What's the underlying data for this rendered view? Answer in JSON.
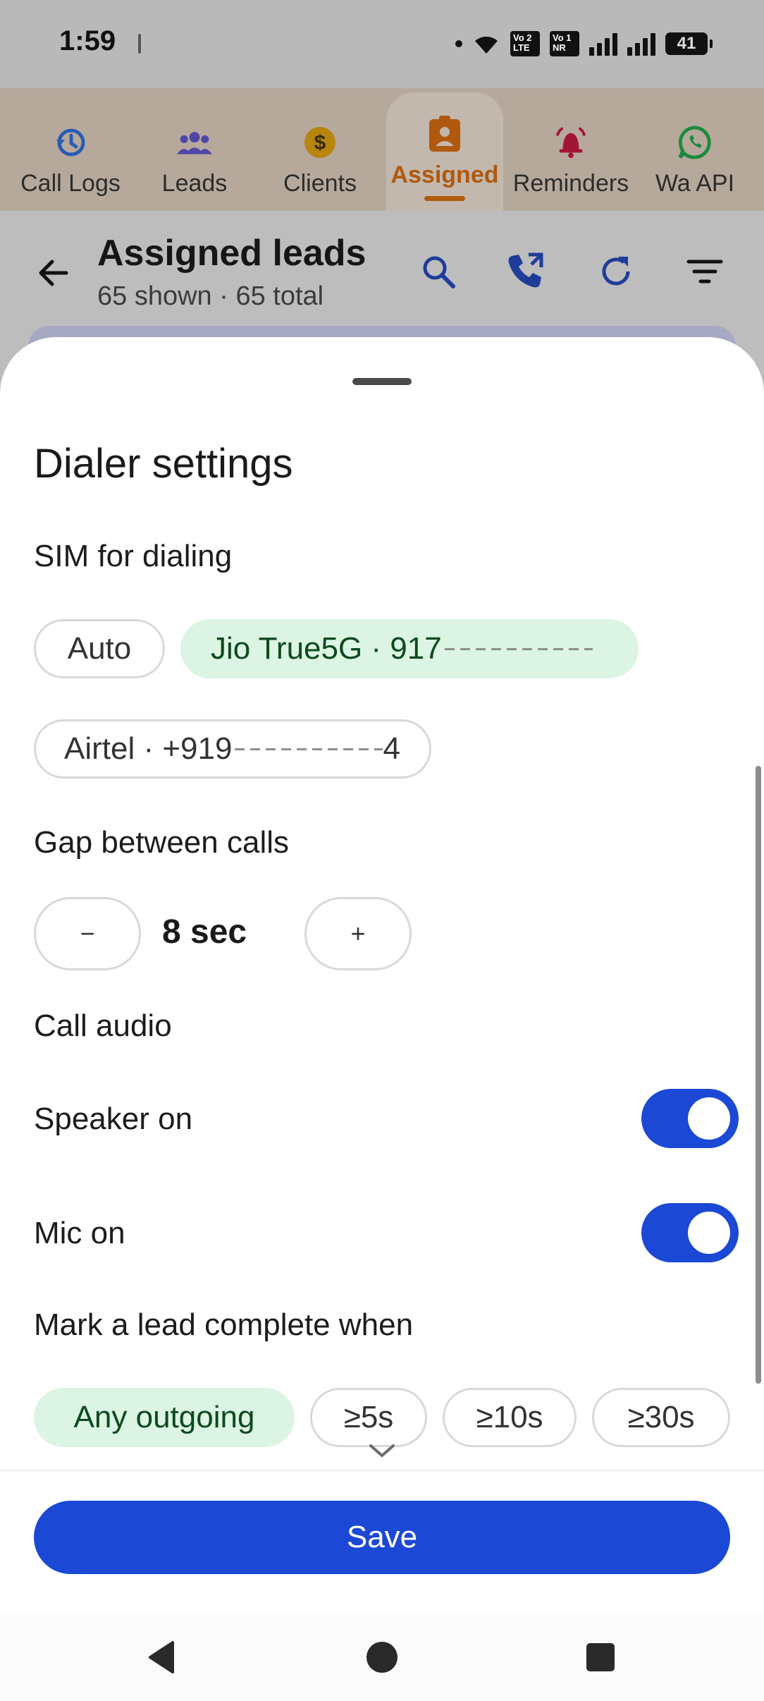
{
  "status_bar": {
    "time": "1:59",
    "sim1_badge": "Vo 2 LTE",
    "sim2_badge": "Vo 1 NR",
    "battery": "41"
  },
  "tabs": [
    {
      "label": "Call Logs",
      "icon": "history-icon",
      "color": "#1f6fd1"
    },
    {
      "label": "Leads",
      "icon": "group-icon",
      "color": "#5b4fc7"
    },
    {
      "label": "Clients",
      "icon": "dollar-coin-icon",
      "color": "#d99a10"
    },
    {
      "label": "Assigned",
      "icon": "assignment-ind-icon",
      "color": "#e37d1b",
      "active": true
    },
    {
      "label": "Reminders",
      "icon": "alarm-bell-icon",
      "color": "#d3163f"
    },
    {
      "label": "Wa API",
      "icon": "whatsapp-icon",
      "color": "#1fbd4a"
    }
  ],
  "header": {
    "title": "Assigned leads",
    "subtitle": "65 shown · 65 total",
    "icons": [
      "search-icon",
      "phone-forward-icon",
      "refresh-icon",
      "filter-icon"
    ]
  },
  "sheet": {
    "title": "Dialer settings",
    "sim_label": "SIM for dialing",
    "sim_options": [
      {
        "label": "Auto",
        "selected": false
      },
      {
        "label": "Jio True5G · 917",
        "masked": true,
        "selected": true
      },
      {
        "label": "Airtel · +919",
        "masked": true,
        "masked_suffix": "4",
        "selected": false
      }
    ],
    "gap_label": "Gap between calls",
    "gap_decrement": "−",
    "gap_value": "8 sec",
    "gap_increment": "+",
    "audio_label": "Call audio",
    "speaker_label": "Speaker on",
    "speaker_on": true,
    "mic_label": "Mic on",
    "mic_on": true,
    "complete_label": "Mark a lead complete when",
    "complete_options": [
      {
        "label": "Any outgoing",
        "selected": true
      },
      {
        "label": "≥5s",
        "selected": false
      },
      {
        "label": "≥10s",
        "selected": false
      },
      {
        "label": "≥30s",
        "selected": false
      }
    ],
    "save_label": "Save"
  },
  "colors": {
    "primary": "#1b48d4",
    "selected_chip": "#dcf4e4",
    "assigned_accent": "#e37d1b"
  }
}
